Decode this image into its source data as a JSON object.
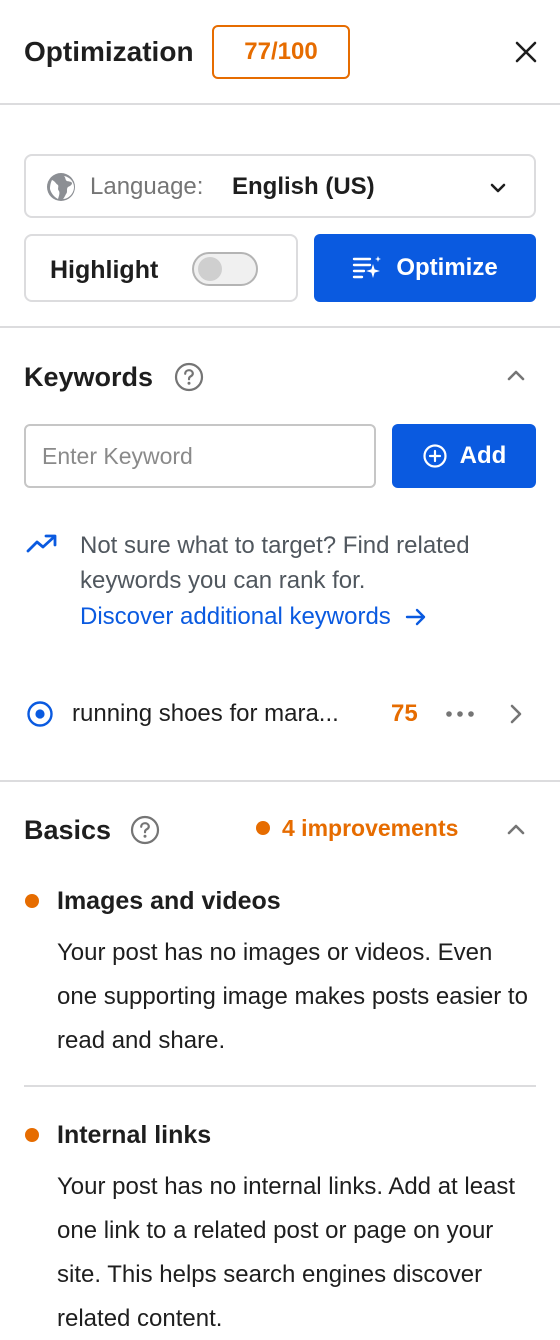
{
  "header": {
    "title": "Optimization",
    "score": "77/100",
    "close_icon": "close-icon"
  },
  "language": {
    "label": "Language:",
    "value": "English (US)",
    "icon": "globe-icon"
  },
  "controls": {
    "highlight_label": "Highlight",
    "highlight_on": false,
    "optimize_label": "Optimize"
  },
  "keywords": {
    "title": "Keywords",
    "input_placeholder": "Enter Keyword",
    "input_value": "",
    "add_label": "Add",
    "hint": "Not sure what to target? Find related keywords you can rank for.",
    "discover_link": "Discover additional keywords",
    "items": [
      {
        "keyword": "running shoes for mara...",
        "score": "75",
        "selected": true
      }
    ]
  },
  "basics": {
    "title": "Basics",
    "improvements": "4 improvements",
    "items": [
      {
        "title": "Images and videos",
        "description": "Your post has no images or videos. Even one supporting image makes posts easier to read and share."
      },
      {
        "title": "Internal links",
        "description": "Your post has no internal links. Add at least one link to a related post or page on your site. This helps search engines discover related content."
      }
    ]
  },
  "colors": {
    "accent_blue": "#0a5ae0",
    "warning_orange": "#e66c00",
    "border_gray": "#dcdcde"
  }
}
